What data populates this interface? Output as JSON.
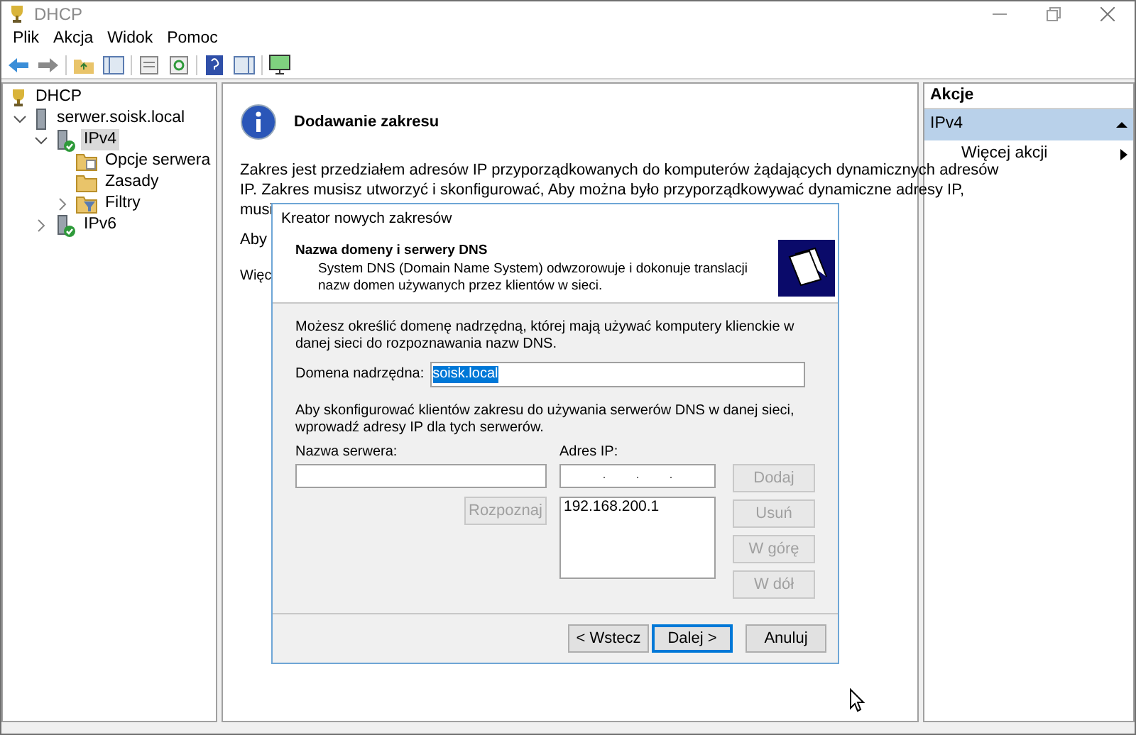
{
  "window": {
    "title": "DHCP"
  },
  "menu": [
    "Plik",
    "Akcja",
    "Widok",
    "Pomoc"
  ],
  "tree": [
    {
      "label": "DHCP",
      "kind": "root",
      "selected": false,
      "children": [
        {
          "label": "serwer.soisk.local",
          "kind": "server",
          "selected": false,
          "expanded": true,
          "children": [
            {
              "label": "IPv4",
              "kind": "protocol",
              "selected": true,
              "expanded": true,
              "children": [
                {
                  "label": "Opcje serwera",
                  "kind": "options",
                  "selected": false
                },
                {
                  "label": "Zasady",
                  "kind": "folder",
                  "selected": false
                },
                {
                  "label": "Filtry",
                  "kind": "filter",
                  "selected": false,
                  "expanded": false
                }
              ]
            },
            {
              "label": "IPv6",
              "kind": "protocol",
              "selected": false,
              "expanded": false
            }
          ]
        }
      ]
    }
  ],
  "main": {
    "heading": "Dodawanie zakresu",
    "lines": [
      "Zakres jest przedziałem adresów IP przyporządkowanych do komputerów żądających dynamicznych adresów",
      "IP. Zakres musisz utworzyć i skonfigurować, Aby można było przyporządkowywać dynamiczne adresy IP,",
      "musi"
    ],
    "partial_texts": [
      "Aby",
      "Więc"
    ]
  },
  "actions": {
    "title": "Akcje",
    "section": {
      "label": "IPv4",
      "expanded": true
    },
    "items": [
      "Więcej akcji"
    ]
  },
  "dialog": {
    "title": "Kreator nowych zakresów",
    "heading": "Nazwa domeny i serwery DNS",
    "description": "System DNS (Domain Name System) odwzorowuje i dokonuje translacji nazw domen używanych przez klientów w sieci.",
    "intro": "Możesz określić domenę nadrzędną, której mają używać komputery klienckie w danej sieci do rozpoznawania nazw DNS.",
    "domain_label": "Domena nadrzędna:",
    "domain_value": "soisk.local",
    "domain_value_selected": true,
    "dns_intro": "Aby skonfigurować klientów zakresu do używania serwerów DNS w danej sieci, wprowadź adresy IP dla tych serwerów.",
    "server_label": "Nazwa serwera:",
    "ip_label": "Adres IP:",
    "ip_separators": [
      ".",
      ".",
      "."
    ],
    "resolve_button": {
      "label": "Rozpoznaj",
      "disabled": true
    },
    "ip_list": [
      "192.168.200.1"
    ],
    "side_buttons": [
      {
        "label": "Dodaj",
        "disabled": true
      },
      {
        "label": "Usuń",
        "disabled": true
      },
      {
        "label": "W górę",
        "disabled": true
      },
      {
        "label": "W dół",
        "disabled": true
      }
    ],
    "nav_buttons": [
      {
        "label": "< Wstecz",
        "default": false
      },
      {
        "label": "Dalej >",
        "default": true
      },
      {
        "label": "Anuluj",
        "default": false
      }
    ]
  }
}
